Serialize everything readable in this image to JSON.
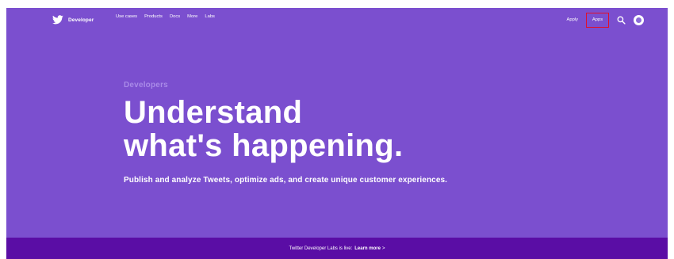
{
  "nav": {
    "brand": "Developer",
    "menu": [
      "Use cases",
      "Products",
      "Docs",
      "More",
      "Labs"
    ],
    "apply": "Apply",
    "apps": "Apps",
    "search_icon": "search-icon",
    "avatar_icon": "user-avatar-icon",
    "logo_icon": "twitter-bird-icon"
  },
  "hero": {
    "eyebrow": "Developers",
    "headline_line1": "Understand",
    "headline_line2": "what's happening.",
    "subtitle": "Publish and analyze Tweets, optimize ads, and create unique customer experiences."
  },
  "banner": {
    "text": "Twitter Developer Labs is live:",
    "link": "Learn more",
    "arrow": ">"
  },
  "colors": {
    "hero_background": "#7b4fcf",
    "banner_background": "#5a0da5",
    "highlight_border": "#e0102a"
  }
}
